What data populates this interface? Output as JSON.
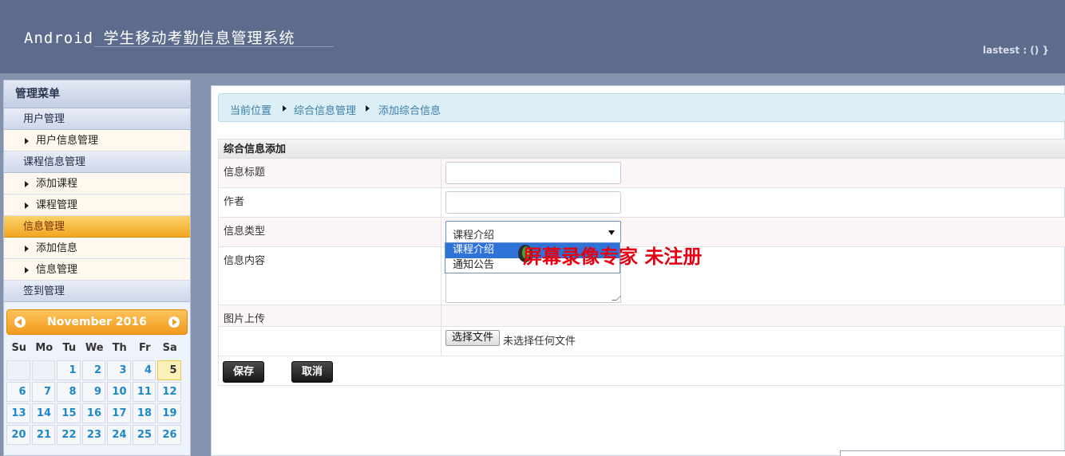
{
  "header": {
    "title": "Android 学生移动考勤信息管理系统",
    "user_status": "lastest : () }"
  },
  "sidebar": {
    "title": "管理菜单",
    "groups": [
      {
        "label": "用户管理",
        "items": [
          "用户信息管理"
        ]
      },
      {
        "label": "课程信息管理",
        "items": [
          "添加课程",
          "课程管理"
        ]
      },
      {
        "label": "信息管理",
        "active": true,
        "items": [
          "添加信息",
          "信息管理"
        ]
      },
      {
        "label": "签到管理",
        "items": []
      }
    ]
  },
  "calendar": {
    "month_label": "November 2016",
    "dows": [
      "Su",
      "Mo",
      "Tu",
      "We",
      "Th",
      "Fr",
      "Sa"
    ],
    "rows": [
      [
        "",
        "",
        "1",
        "2",
        "3",
        "4",
        "5"
      ],
      [
        "6",
        "7",
        "8",
        "9",
        "10",
        "11",
        "12"
      ],
      [
        "13",
        "14",
        "15",
        "16",
        "17",
        "18",
        "19"
      ],
      [
        "20",
        "21",
        "22",
        "23",
        "24",
        "25",
        "26"
      ]
    ],
    "today": "5"
  },
  "breadcrumb": {
    "current": "当前位置",
    "section": "综合信息管理",
    "page": "添加综合信息"
  },
  "form": {
    "caption": "综合信息添加",
    "labels": {
      "title": "信息标题",
      "author": "作者",
      "type": "信息类型",
      "content": "信息内容",
      "image": "图片上传"
    },
    "type_selected": "课程介绍",
    "type_options": [
      "课程介绍",
      "通知公告"
    ],
    "file_button": "选择文件",
    "file_status": "未选择任何文件",
    "save": "保存",
    "cancel": "取消"
  },
  "watermark": {
    "text": "屏幕录像专家 未注册"
  },
  "colors": {
    "header_bg": "#5d6b8d",
    "active_menu": "#f1a622",
    "calendar_head": "#f29a1d",
    "link_blue": "#3b7ea6",
    "option_selected": "#2f73d8",
    "watermark_red": "#e60012"
  }
}
